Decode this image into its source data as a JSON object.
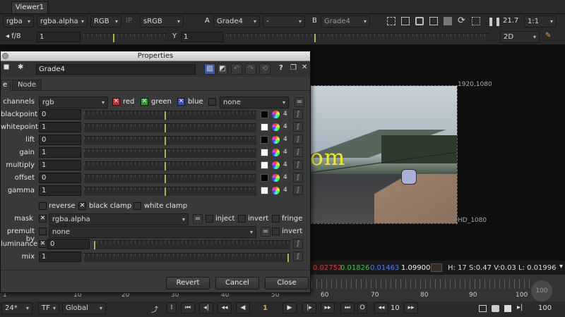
{
  "viewer_tab": "Viewer1",
  "toolbar1": {
    "channels": "rgba",
    "alpha": "rgba.alpha",
    "colorspace": "RGB",
    "ip": "IP",
    "lut": "sRGB",
    "input_a_label": "A",
    "input_a": "Grade4",
    "op": "-",
    "input_b_label": "B",
    "input_b": "Grade4",
    "fps": "21.7",
    "zoom": "1:1"
  },
  "toolbar2": {
    "fstop": "f/8",
    "gain_value": "1",
    "y_label": "Y",
    "gamma_value": "1",
    "view_mode": "2D"
  },
  "panel": {
    "title": "Properties",
    "node_name": "Grade4",
    "tabs": [
      "e",
      "Node"
    ],
    "channels_label": "channels",
    "channels_value": "rgb",
    "red": "red",
    "green": "green",
    "blue": "blue",
    "extra_channel": "none",
    "knobs": [
      {
        "label": "blackpoint",
        "value": "0",
        "count": "4"
      },
      {
        "label": "whitepoint",
        "value": "1",
        "count": "4"
      },
      {
        "label": "lift",
        "value": "0",
        "count": "4"
      },
      {
        "label": "gain",
        "value": "1",
        "count": "4"
      },
      {
        "label": "multiply",
        "value": "1",
        "count": "4"
      },
      {
        "label": "offset",
        "value": "0",
        "count": "4"
      },
      {
        "label": "gamma",
        "value": "1",
        "count": "4"
      }
    ],
    "reverse": "reverse",
    "black_clamp": "black clamp",
    "white_clamp": "white clamp",
    "mask_label": "mask",
    "mask_value": "rgba.alpha",
    "inject": "inject",
    "invert": "invert",
    "fringe": "fringe",
    "premult_label": "premult by",
    "premult_value": "none",
    "premult_invert": "invert",
    "luminance_label": "luminance",
    "luminance_value": "0",
    "mix_label": "mix",
    "mix_value": "1",
    "revert": "Revert",
    "cancel": "Cancel",
    "close": "Close"
  },
  "viewer": {
    "top_res": "1920,1080",
    "bottom_res": "HD_1080",
    "watermark": "www.cgtsj.com",
    "pixel_r": "0.02752",
    "pixel_g": "0.01826",
    "pixel_b": "0.01463",
    "pixel_a": "1.09900",
    "hsv": "H: 17 S:0.47 V:0.03",
    "lum": "L: 0.01996"
  },
  "timeline": {
    "ticks": [
      "1",
      "10",
      "20",
      "30",
      "40",
      "50",
      "60",
      "70",
      "80",
      "90",
      "100"
    ],
    "end_frame": "100",
    "fps": "24*",
    "tf": "TF",
    "scope": "Global",
    "current_frame": "1",
    "step": "10",
    "out_frame": "100"
  },
  "colors": {
    "pixel_r": "#e03535",
    "pixel_g": "#3fc63f",
    "pixel_b": "#4f7cff",
    "watermark": "#f3ea1e",
    "accent": "#e8a24a"
  }
}
